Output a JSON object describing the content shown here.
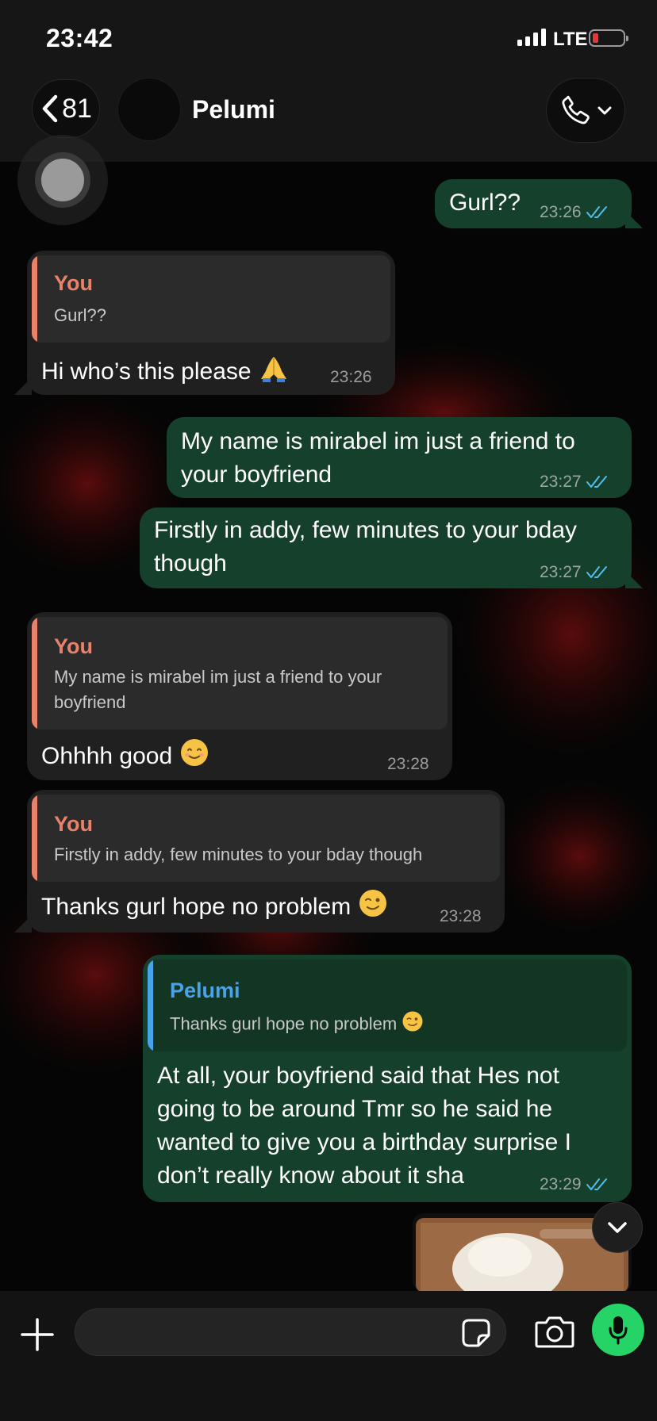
{
  "status_bar": {
    "time": "23:42",
    "network": "LTE"
  },
  "header": {
    "back_count": "81",
    "contact_name": "Pelumi"
  },
  "messages": [
    {
      "dir": "out",
      "text": "Gurl??",
      "time": "23:26"
    },
    {
      "dir": "in",
      "quote_name": "You",
      "quote_text": "Gurl??",
      "text": "Hi who’s this please",
      "time": "23:26"
    },
    {
      "dir": "out",
      "text_line1": "My name is mirabel im just a friend to",
      "text_line2": "your boyfriend",
      "time": "23:27"
    },
    {
      "dir": "out",
      "text_line1": "Firstly in addy, few minutes to your bday",
      "text_line2": "though",
      "time": "23:27"
    },
    {
      "dir": "in",
      "quote_name": "You",
      "quote_line1": "My name is mirabel im just a friend to your",
      "quote_line2": "boyfriend",
      "text": "Ohhhh good",
      "time": "23:28"
    },
    {
      "dir": "in",
      "quote_name": "You",
      "quote_text": "Firstly in addy, few minutes to your bday though",
      "text": "Thanks gurl hope no problem",
      "time": "23:28"
    },
    {
      "dir": "out",
      "quote_name": "Pelumi",
      "quote_text": "Thanks gurl hope no problem",
      "text_line1": "At all, your boyfriend said that Hes not",
      "text_line2": "going to be around Tmr so he said he",
      "text_line3": "wanted to give you a birthday surprise I",
      "text_line4": "don’t really know about it sha",
      "time": "23:29"
    }
  ],
  "colors": {
    "outgoing_bubble": "#15402c",
    "incoming_bubble": "#202020",
    "quote_you": "#e8826a",
    "quote_pelumi": "#4aa3e8",
    "read_ticks": "#53bdeb",
    "mic_button": "#25d366"
  },
  "icons": [
    "back-chevron-icon",
    "phone-icon",
    "chevron-down-icon",
    "read-receipt-icon",
    "plus-icon",
    "sticker-icon",
    "camera-icon",
    "microphone-icon"
  ]
}
